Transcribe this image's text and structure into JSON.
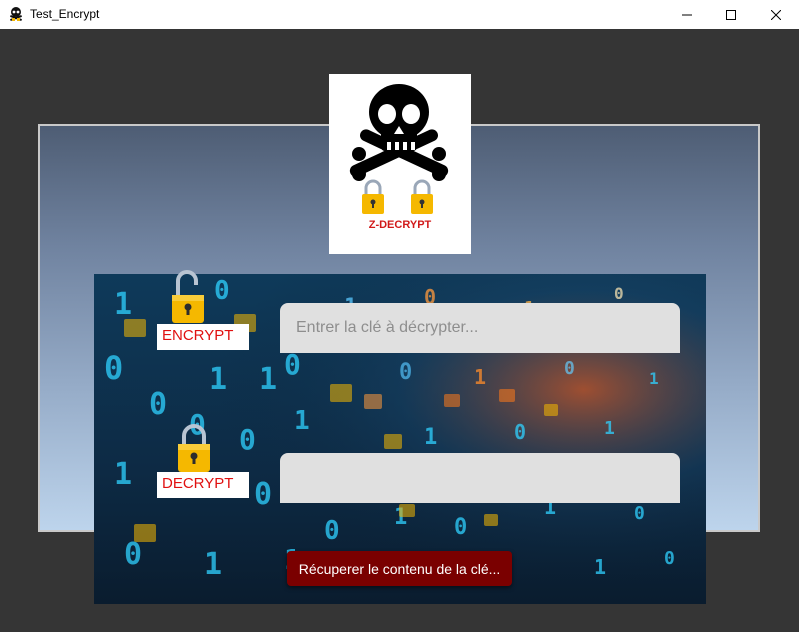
{
  "window": {
    "title": "Test_Encrypt",
    "controls": [
      "minimize",
      "maximize",
      "close"
    ]
  },
  "logo": {
    "icon": "skull-crossbones-padlocks-icon",
    "text": "Z-DECRYPT"
  },
  "labels": {
    "encrypt": "ENCRYPT",
    "decrypt": "DECRYPT"
  },
  "inputs": {
    "key_placeholder": "Entrer la clé à décrypter...",
    "key_value": "",
    "result_value": ""
  },
  "buttons": {
    "recover_label": "Récuperer le contenu de la clé..."
  },
  "colors": {
    "background": "#353535",
    "label_text": "#e01010",
    "button": "#7a0000",
    "input": "#e0e0e0"
  }
}
